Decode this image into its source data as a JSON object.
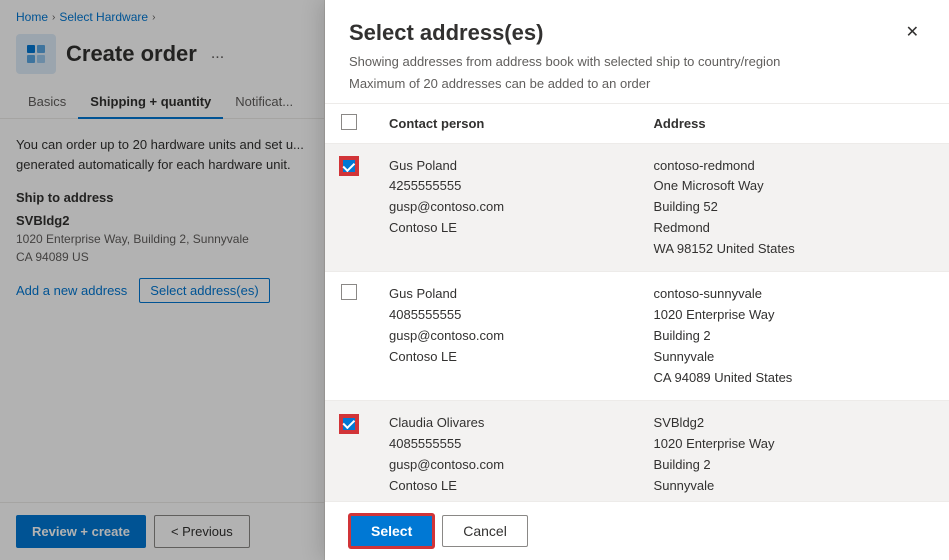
{
  "breadcrumb": {
    "home": "Home",
    "separator1": "›",
    "select_hardware": "Select Hardware",
    "separator2": "›"
  },
  "page": {
    "title": "Create order",
    "menu_icon": "...",
    "icon_label": "order-icon"
  },
  "tabs": [
    {
      "label": "Basics",
      "active": false
    },
    {
      "label": "Shipping + quantity",
      "active": true
    },
    {
      "label": "Notificat...",
      "active": false
    }
  ],
  "left_content": {
    "description": "You can order up to 20 hardware units and set u... generated automatically for each hardware unit.",
    "ship_to_label": "Ship to address",
    "address_name": "SVBldg2",
    "address_detail": "1020 Enterprise Way, Building 2, Sunnyvale\nCA 94089 US",
    "add_new_link": "Add a new address",
    "select_address_btn": "Select address(es)"
  },
  "bottom_bar": {
    "review_create": "Review + create",
    "previous": "< Previous"
  },
  "modal": {
    "title": "Select address(es)",
    "subtitle1": "Showing addresses from address book with selected ship to country/region",
    "subtitle2": "Maximum of 20 addresses can be added to an order",
    "close_icon": "✕",
    "table": {
      "col_contact": "Contact person",
      "col_address": "Address",
      "rows": [
        {
          "checked": true,
          "contact_name": "Gus Poland",
          "contact_phone": "4255555555",
          "contact_email": "gusp@contoso.com",
          "contact_company": "Contoso LE",
          "address_site": "contoso-redmond",
          "address_line1": "One Microsoft Way",
          "address_line2": "Building 52",
          "address_city": "Redmond",
          "address_state_zip": "WA 98152 United States",
          "highlighted": true
        },
        {
          "checked": false,
          "contact_name": "Gus Poland",
          "contact_phone": "4085555555",
          "contact_email": "gusp@contoso.com",
          "contact_company": "Contoso LE",
          "address_site": "contoso-sunnyvale",
          "address_line1": "1020 Enterprise Way",
          "address_line2": "Building 2",
          "address_city": "Sunnyvale",
          "address_state_zip": "CA 94089 United States",
          "highlighted": false
        },
        {
          "checked": true,
          "contact_name": "Claudia Olivares",
          "contact_phone": "4085555555",
          "contact_email": "gusp@contoso.com",
          "contact_company": "Contoso LE",
          "address_site": "SVBldg2",
          "address_line1": "1020 Enterprise Way",
          "address_line2": "Building 2",
          "address_city": "Sunnyvale",
          "address_state_zip": "",
          "highlighted": true
        }
      ]
    },
    "select_btn": "Select",
    "cancel_btn": "Cancel"
  }
}
